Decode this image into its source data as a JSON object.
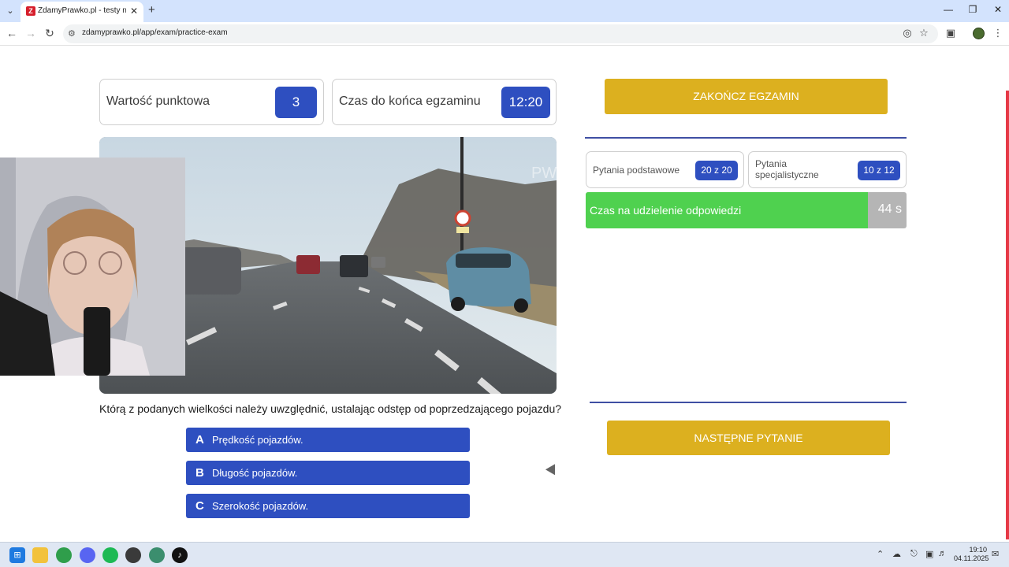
{
  "browser": {
    "tab_title": "ZdamyPrawko.pl - testy na prawo jazdy",
    "favicon_letter": "Z",
    "url": "zdamyprawko.pl/app/exam/practice-exam"
  },
  "exam": {
    "points_label": "Wartość punktowa",
    "points_value": "3",
    "time_label": "Czas do końca egzaminu",
    "time_value": "12:20",
    "end_button": "ZAKOŃCZ EGZAMIN",
    "basic_label": "Pytania podstawowe",
    "basic_value": "20 z 20",
    "special_label": "Pytania specjalistyczne",
    "special_value": "10 z 12",
    "answer_time_label": "Czas na udzielenie odpowiedzi",
    "answer_time_value": "44 s",
    "answer_time_fraction": 0.88,
    "watermark": "PWPW",
    "question": "Którą z podanych wielkości należy uwzględnić, ustalając odstęp od poprzedzającego pojazdu?",
    "answers": [
      {
        "letter": "A",
        "text": "Prędkość pojazdów."
      },
      {
        "letter": "B",
        "text": "Długość pojazdów."
      },
      {
        "letter": "C",
        "text": "Szerokość pojazdów."
      }
    ],
    "next_button": "NASTĘPNE PYTANIE"
  },
  "taskbar": {
    "time": "19:10",
    "date": "04.11.2025"
  },
  "colors": {
    "accent_blue": "#2e4fc0",
    "accent_yellow": "#dcb01f",
    "timer_green": "#4fd14f"
  }
}
